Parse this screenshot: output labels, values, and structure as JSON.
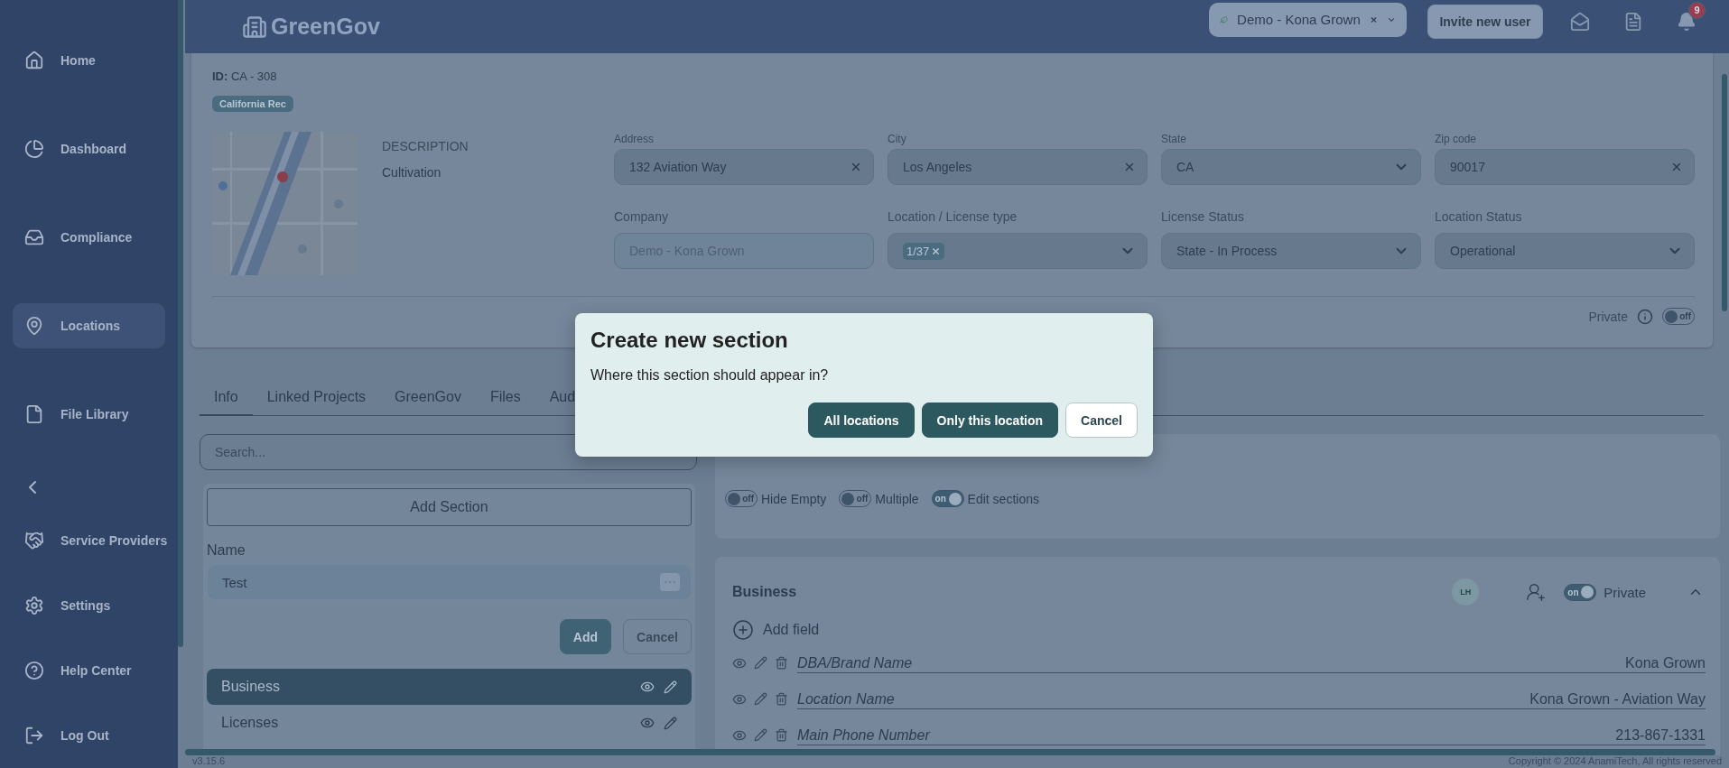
{
  "sidebar": {
    "items": [
      {
        "kind": "link",
        "label": "Home",
        "selected": false
      },
      {
        "kind": "link",
        "label": "Dashboard",
        "selected": false
      },
      {
        "kind": "link",
        "label": "Compliance",
        "selected": false
      },
      {
        "kind": "link",
        "label": "Locations",
        "selected": true
      },
      {
        "kind": "link",
        "label": "File Library",
        "selected": false
      },
      {
        "kind": "collapse"
      },
      {
        "kind": "link",
        "label": "Service Providers",
        "selected": false
      },
      {
        "kind": "link",
        "label": "Settings",
        "selected": false
      },
      {
        "kind": "link",
        "label": "Help Center",
        "selected": false
      },
      {
        "kind": "link",
        "label": "Log Out",
        "selected": false
      }
    ]
  },
  "header": {
    "logo": "GreenGov",
    "org": "Demo - Kona Grown",
    "invite": "Invite new user",
    "notifications": "9"
  },
  "location": {
    "id_label": "ID:",
    "id": "CA - 308",
    "badge": "California Rec",
    "description_label": "DESCRIPTION",
    "description": "Cultivation",
    "fields": [
      {
        "label": "Address",
        "value": "132 Aviation Way",
        "kind": "text"
      },
      {
        "label": "City",
        "value": "Los Angeles",
        "kind": "text"
      },
      {
        "label": "State",
        "value": "CA",
        "kind": "select"
      },
      {
        "label": "Zip code",
        "value": "90017",
        "kind": "text"
      },
      {
        "label": "Company",
        "value": "Demo - Kona Grown",
        "kind": "disabled"
      },
      {
        "label": "Location / License type",
        "value": "1/37",
        "kind": "tags"
      },
      {
        "label": "License Status",
        "value": "State - In Process",
        "kind": "select"
      },
      {
        "label": "Location Status",
        "value": "Operational",
        "kind": "select"
      }
    ],
    "private": {
      "label": "Private",
      "on": false,
      "text": "off"
    }
  },
  "tabs": [
    {
      "label": "Info",
      "selected": true
    },
    {
      "label": "Linked Projects",
      "selected": false
    },
    {
      "label": "GreenGov",
      "selected": false
    },
    {
      "label": "Files",
      "selected": false
    },
    {
      "label": "Aud",
      "selected": false
    }
  ],
  "search": {
    "placeholder": "Search..."
  },
  "section_editor": {
    "add_section": "Add Section",
    "name_label": "Name",
    "name_value": "Test",
    "add": "Add",
    "cancel": "Cancel"
  },
  "sections": [
    {
      "label": "Business",
      "selected": true
    },
    {
      "label": "Licenses",
      "selected": false
    }
  ],
  "filters": [
    {
      "label": "Hide Empty",
      "on": false,
      "text": "off"
    },
    {
      "label": "Multiple",
      "on": false,
      "text": "off"
    },
    {
      "label": "Edit sections",
      "on": true,
      "text": "on"
    }
  ],
  "business": {
    "title": "Business",
    "avatar": "LH",
    "private": {
      "label": "Private",
      "on": true,
      "text": "on"
    },
    "add_field": "Add field",
    "rows": [
      {
        "label": "DBA/Brand Name",
        "value": "Kona Grown"
      },
      {
        "label": "Location Name",
        "value": "Kona Grown - Aviation Way"
      },
      {
        "label": "Main Phone Number",
        "value": "213-867-1331"
      }
    ]
  },
  "footer": {
    "version": "v3.15.6",
    "copyright": "Copyright © 2024 AnamiTech, All rights reserved"
  },
  "dialog": {
    "title": "Create new section",
    "message": "Where this section should appear in?",
    "buttons": [
      {
        "label": "All locations",
        "kind": "primary"
      },
      {
        "label": "Only this location",
        "kind": "primary"
      },
      {
        "label": "Cancel",
        "kind": "secondary"
      }
    ]
  }
}
